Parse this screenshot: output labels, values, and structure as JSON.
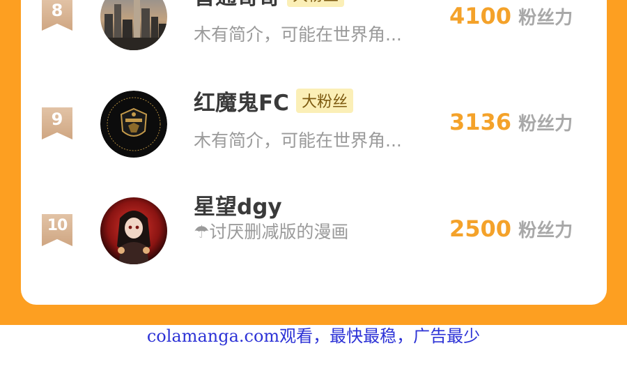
{
  "colors": {
    "frame": "#fd9f21",
    "score": "#f4a22a",
    "fan_tag_bg": "#fbefb7",
    "footer": "#2c32d6"
  },
  "ranking": [
    {
      "rank": "8",
      "name": "普通哥哥",
      "tag": "大粉丝",
      "bio": "木有简介，可能在世界角...",
      "score": "4100",
      "score_unit": "粉丝力",
      "avatar": "city-skyline-avatar"
    },
    {
      "rank": "9",
      "name": "红魔鬼FC",
      "tag": "大粉丝",
      "bio": "木有简介，可能在世界角...",
      "score": "3136",
      "score_unit": "粉丝力",
      "avatar": "manchester-united-crest-avatar"
    },
    {
      "rank": "10",
      "name": "星望dgy",
      "bio_icon": "umbrella-icon",
      "bio": "☂讨厌删减版的漫画",
      "score": "2500",
      "score_unit": "粉丝力",
      "avatar": "anime-girl-red-moon-avatar"
    }
  ],
  "footer": {
    "text": "colamanga.com观看，最快最稳，广告最少"
  }
}
